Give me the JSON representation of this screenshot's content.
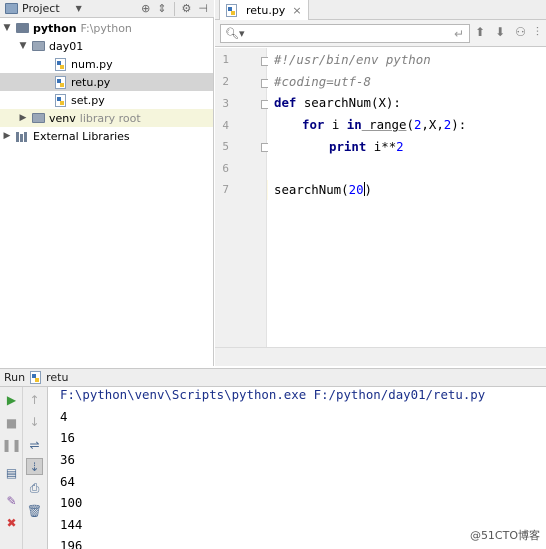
{
  "project_panel": {
    "title": "Project",
    "header_icons": [
      "target-icon",
      "split-icon",
      "gear-icon",
      "hide-icon"
    ],
    "tree": [
      {
        "label": "python",
        "hint": "F:\\python",
        "type": "folder",
        "level": 0,
        "expanded": true
      },
      {
        "label": "day01",
        "type": "folder",
        "level": 1,
        "expanded": true
      },
      {
        "label": "num.py",
        "type": "python-file",
        "level": 2
      },
      {
        "label": "retu.py",
        "type": "python-file",
        "level": 2,
        "selected": true
      },
      {
        "label": "set.py",
        "type": "python-file",
        "level": 2
      },
      {
        "label": "venv",
        "hint": "library root",
        "type": "folder",
        "level": 1,
        "expanded": false
      },
      {
        "label": "External Libraries",
        "type": "library",
        "level": 0,
        "expanded": false
      }
    ]
  },
  "editor": {
    "tab_label": "retu.py",
    "find_placeholder": "",
    "find_tools": [
      "up-arrow-icon",
      "down-arrow-icon",
      "find-usages-icon",
      "filter-icon"
    ],
    "line_numbers": [
      "1",
      "2",
      "3",
      "4",
      "5",
      "6",
      "7"
    ],
    "code": {
      "l1": "#!/usr/bin/env python",
      "l2": "#coding=utf-8",
      "l3_kw": "def",
      "l3_rest": " searchNum(X):",
      "l4_for": "for",
      "l4_i": " i ",
      "l4_in": "in",
      "l4_range": " range",
      "l4_paren": "(",
      "l4_n1": "2",
      "l4_mid": ",X,",
      "l4_n2": "2",
      "l4_end": "):",
      "l5_kw": "print",
      "l5_rest": " i**",
      "l5_num": "2",
      "l7_fn": "searchNum(",
      "l7_num": "20",
      "l7_close": ")"
    }
  },
  "run_panel": {
    "label": "Run",
    "config_name": "retu",
    "command": "F:\\python\\venv\\Scripts\\python.exe F:/python/day01/retu.py",
    "output": [
      "4",
      "16",
      "36",
      "64",
      "100",
      "144",
      "196"
    ],
    "watermark": "@51CTO博客"
  },
  "colors": {
    "keyword": "#000080",
    "comment": "#808080",
    "number": "#0000ff",
    "selection": "#d4d4d4",
    "current_line": "#fffae3",
    "run_green": "#3c9a3c",
    "stop_red": "#d23c3c"
  }
}
